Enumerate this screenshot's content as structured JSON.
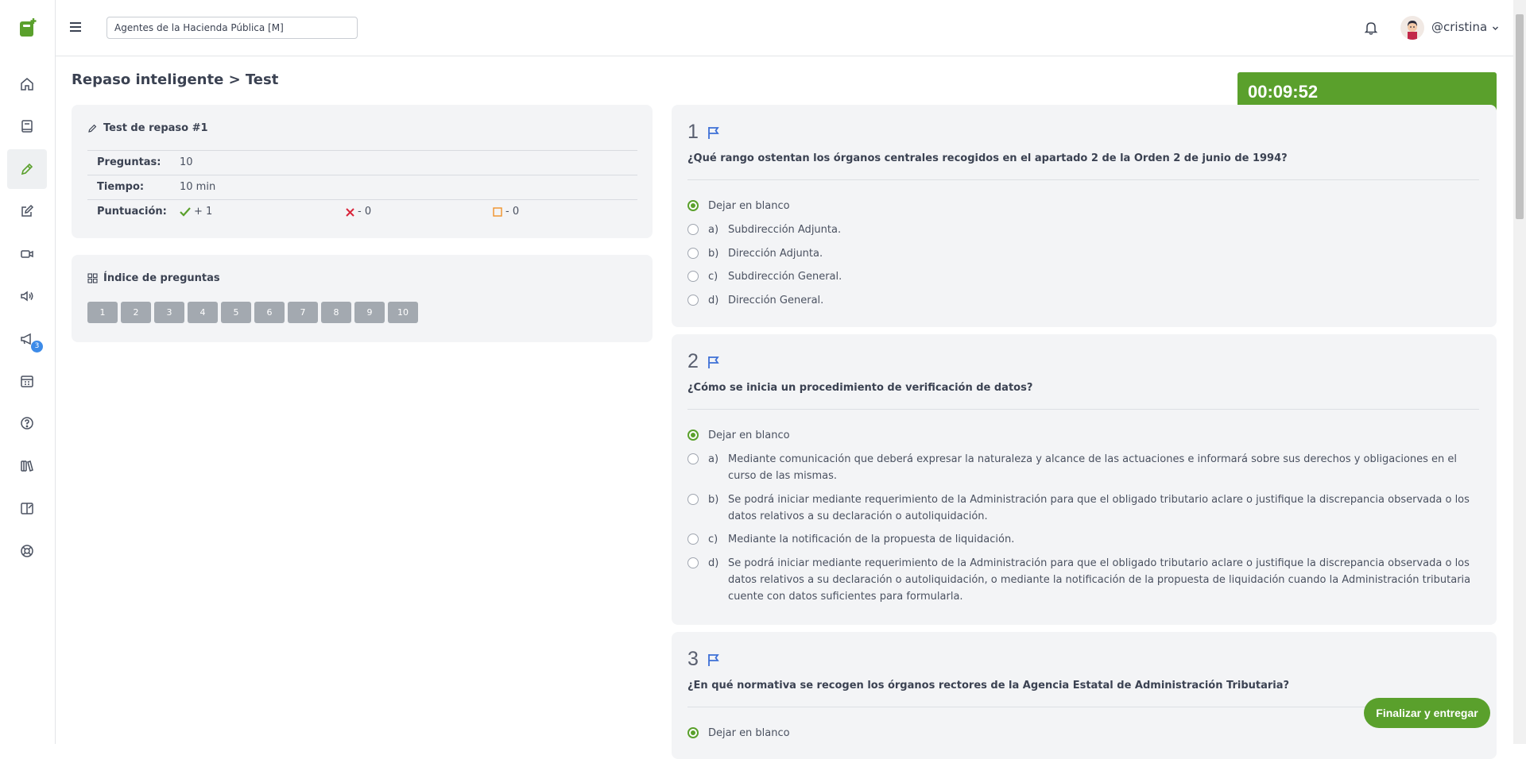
{
  "header": {
    "course": "Agentes de la Hacienda Pública [M]",
    "username": "@cristina"
  },
  "sidebar": {
    "items": [
      {
        "icon": "home-icon"
      },
      {
        "icon": "book-icon"
      },
      {
        "icon": "pencil-icon",
        "active": true
      },
      {
        "icon": "edit-icon"
      },
      {
        "icon": "video-icon"
      },
      {
        "icon": "audio-icon"
      },
      {
        "icon": "megaphone-icon",
        "badge": "3"
      },
      {
        "icon": "calendar-icon"
      },
      {
        "icon": "help-icon"
      },
      {
        "icon": "library-icon"
      },
      {
        "icon": "tag-book-icon"
      },
      {
        "icon": "support-icon"
      }
    ]
  },
  "page": {
    "title": "Repaso inteligente > Test"
  },
  "timer": "00:09:52",
  "test_info": {
    "title": "Test de repaso #1",
    "questions_label": "Preguntas:",
    "questions_value": "10",
    "time_label": "Tiempo:",
    "time_value": "10 min",
    "score_label": "Puntuación:",
    "score_correct": "+ 1",
    "score_wrong": "- 0",
    "score_blank": "- 0"
  },
  "question_index": {
    "title": "Índice de preguntas",
    "numbers": [
      "1",
      "2",
      "3",
      "4",
      "5",
      "6",
      "7",
      "8",
      "9",
      "10"
    ]
  },
  "questions": [
    {
      "number": "1",
      "text": "¿Qué rango ostentan los órganos centrales recogidos en el apartado 2 de la Orden 2 de junio de 1994?",
      "blank": "Dejar en blanco",
      "options": [
        {
          "letter": "a)",
          "text": "Subdirección Adjunta."
        },
        {
          "letter": "b)",
          "text": "Dirección Adjunta."
        },
        {
          "letter": "c)",
          "text": "Subdirección General."
        },
        {
          "letter": "d)",
          "text": "Dirección General."
        }
      ]
    },
    {
      "number": "2",
      "text": "¿Cómo se inicia un procedimiento de verificación de datos?",
      "blank": "Dejar en blanco",
      "options": [
        {
          "letter": "a)",
          "text": "Mediante comunicación que deberá expresar la naturaleza y alcance de las actuaciones e informará sobre sus derechos y obligaciones en el curso de las mismas."
        },
        {
          "letter": "b)",
          "text": "Se podrá iniciar mediante requerimiento de la Administración para que el obligado tributario aclare o justifique la discrepancia observada o los datos relativos a su declaración o autoliquidación."
        },
        {
          "letter": "c)",
          "text": "Mediante la notificación de la propuesta de liquidación."
        },
        {
          "letter": "d)",
          "text": "Se podrá iniciar mediante requerimiento de la Administración para que el obligado tributario aclare o justifique la discrepancia observada o los datos relativos a su declaración o autoliquidación, o mediante la notificación de la propuesta de liquidación cuando la Administración tributaria cuente con datos suficientes para formularla."
        }
      ]
    },
    {
      "number": "3",
      "text": "¿En qué normativa se recogen los órganos rectores de la Agencia Estatal de Administración Tributaria?",
      "blank": "Dejar en blanco"
    }
  ],
  "finish_button": "Finalizar y entregar",
  "colors": {
    "accent": "#5aa02c",
    "flag": "#3d6fd6",
    "badge": "#3d8be8"
  }
}
